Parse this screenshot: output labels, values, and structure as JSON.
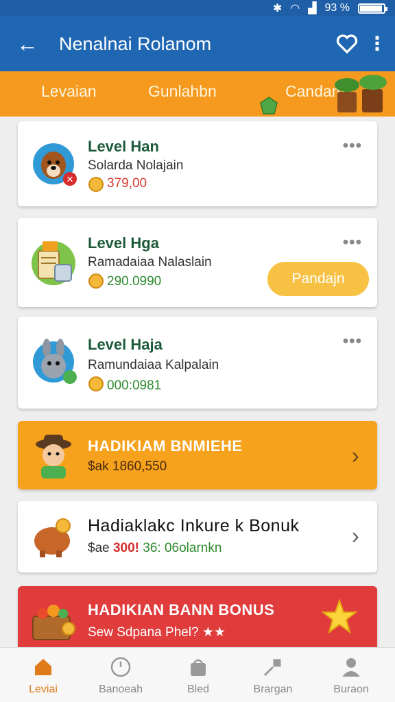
{
  "status": {
    "battery": "93 %",
    "battery_level": 0.93
  },
  "appbar": {
    "title": "Nenalnai Rolanom"
  },
  "tabs": [
    {
      "label": "Levaian"
    },
    {
      "label": "Gunlahbn"
    },
    {
      "label": "Candam"
    }
  ],
  "cards": [
    {
      "title": "Level Han",
      "subtitle": "Solarda Nolajain",
      "value": "379,00"
    },
    {
      "title": "Level Hga",
      "subtitle": "Ramadaiaa Nalaslain",
      "value": "290.0990",
      "button": "Pandajn"
    },
    {
      "title": "Level Haja",
      "subtitle": "Ramundaiaa Kalpalain",
      "value": "000:0981"
    }
  ],
  "banners": [
    {
      "title": "HADIKIAM BNMIEHE",
      "subtitle": "$ak 1860,550"
    },
    {
      "title": "Hadiaklakc Inkure k Bonuk",
      "sub_prefix": "$ae ",
      "sub_red": "300!",
      "sub_green": " 36: 06olarnkn"
    },
    {
      "title": "HADIKIAN BANN BONUS",
      "subtitle": "Sew Sdpana Phel? ★★"
    }
  ],
  "nav": [
    {
      "label": "Leviai",
      "active": true
    },
    {
      "label": "Banoeah"
    },
    {
      "label": "Bled"
    },
    {
      "label": "Brargan"
    },
    {
      "label": "Buraon"
    }
  ],
  "colors": {
    "primary": "#1f66b3",
    "accent_orange": "#f59a1e",
    "banner_red": "#e03c3c",
    "pill_yellow": "#f7c144"
  }
}
